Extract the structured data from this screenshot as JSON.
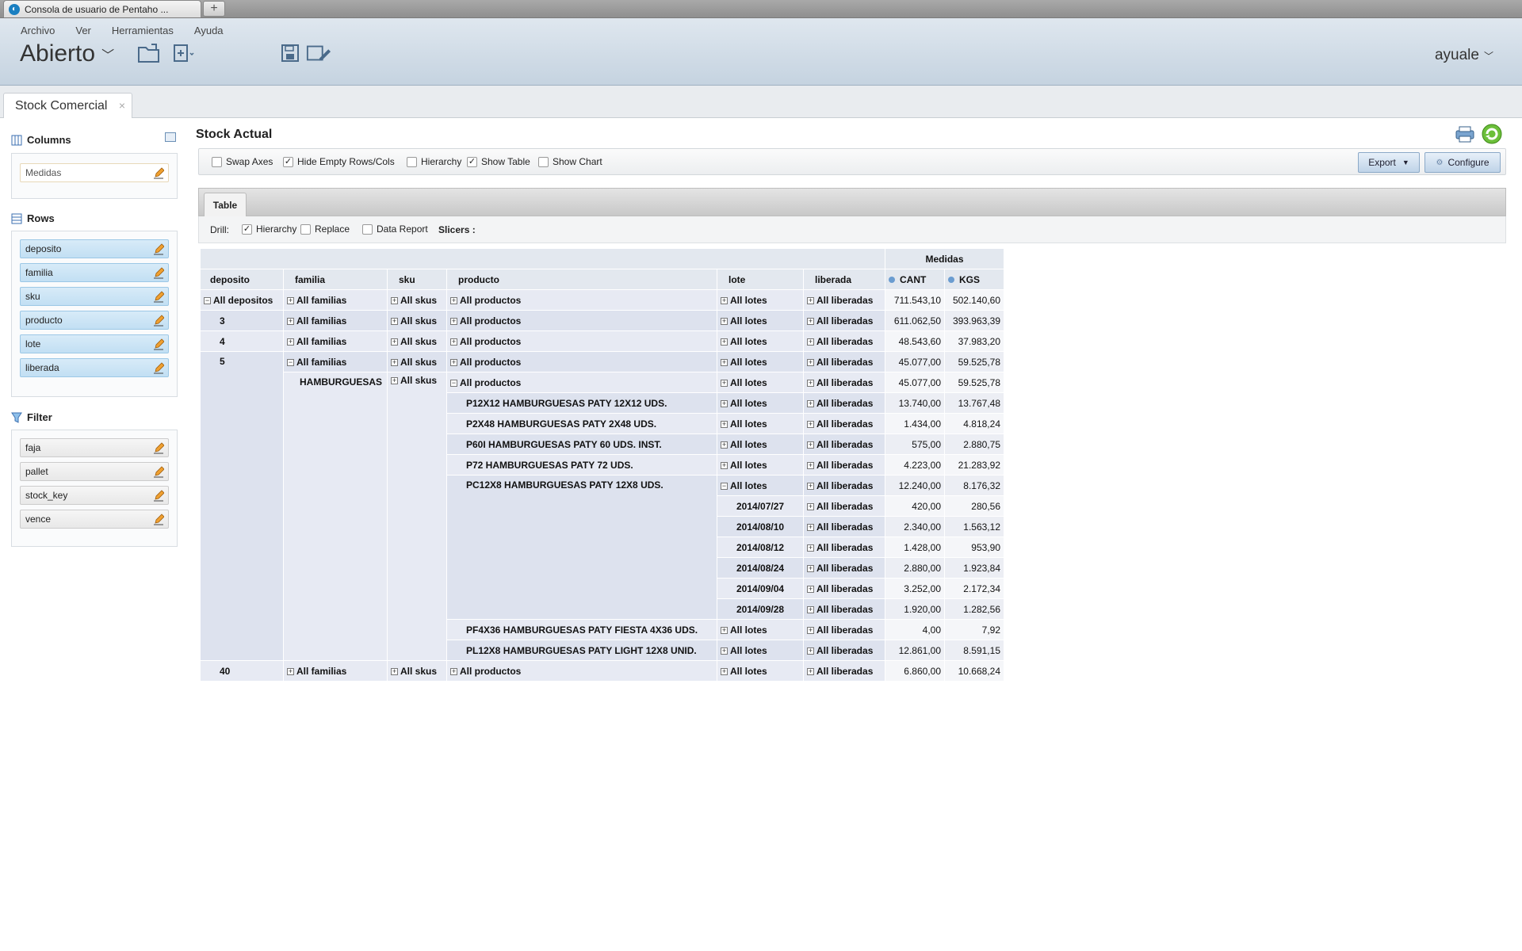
{
  "browser": {
    "tab_title": "Consola de usuario de Pentaho ...",
    "new_tab": "+"
  },
  "header": {
    "menu": [
      "Archivo",
      "Ver",
      "Herramientas",
      "Ayuda"
    ],
    "perspective": "Abierto",
    "user": "ayuale"
  },
  "doc_tab": {
    "label": "Stock Comercial",
    "close": "×"
  },
  "sidebar": {
    "columns_title": "Columns",
    "columns": [
      "Medidas"
    ],
    "rows_title": "Rows",
    "rows": [
      "deposito",
      "familia",
      "sku",
      "producto",
      "lote",
      "liberada"
    ],
    "filter_title": "Filter",
    "filters": [
      "faja",
      "pallet",
      "stock_key",
      "vence"
    ]
  },
  "report": {
    "title": "Stock Actual",
    "options": {
      "swap_axes": "Swap Axes",
      "hide_empty": "Hide Empty Rows/Cols",
      "hierarchy": "Hierarchy",
      "show_table": "Show Table",
      "show_chart": "Show Chart"
    },
    "export": "Export",
    "configure": "Configure",
    "table_tab": "Table",
    "drill": {
      "label": "Drill:",
      "hierarchy": "Hierarchy",
      "replace": "Replace",
      "data_report": "Data Report",
      "slicers": "Slicers :"
    }
  },
  "pivot": {
    "measures_group": "Medidas",
    "headers": [
      "deposito",
      "familia",
      "sku",
      "producto",
      "lote",
      "liberada"
    ],
    "measures": [
      "CANT",
      "KGS"
    ],
    "labels": {
      "all_depositos": "All depositos",
      "all_familias": "All familias",
      "all_skus": "All skus",
      "all_productos": "All productos",
      "all_lotes": "All lotes",
      "all_liberadas": "All liberadas",
      "hamburguesas": "HAMBURGUESAS"
    },
    "rows": [
      {
        "deposito": "All depositos",
        "cant": "711.543,10",
        "kgs": "502.140,60"
      },
      {
        "deposito": "3",
        "cant": "611.062,50",
        "kgs": "393.963,39"
      },
      {
        "deposito": "4",
        "cant": "48.543,60",
        "kgs": "37.983,20"
      },
      {
        "deposito": "5",
        "cant": "45.077,00",
        "kgs": "59.525,78"
      },
      {
        "familia": "HAMBURGUESAS",
        "cant": "45.077,00",
        "kgs": "59.525,78"
      },
      {
        "producto": "P12X12 HAMBURGUESAS PATY 12X12 UDS.",
        "cant": "13.740,00",
        "kgs": "13.767,48"
      },
      {
        "producto": "P2X48 HAMBURGUESAS PATY 2X48 UDS.",
        "cant": "1.434,00",
        "kgs": "4.818,24"
      },
      {
        "producto": "P60I HAMBURGUESAS PATY 60 UDS. INST.",
        "cant": "575,00",
        "kgs": "2.880,75"
      },
      {
        "producto": "P72 HAMBURGUESAS PATY 72 UDS.",
        "cant": "4.223,00",
        "kgs": "21.283,92"
      },
      {
        "producto": "PC12X8 HAMBURGUESAS PATY 12X8 UDS.",
        "cant": "12.240,00",
        "kgs": "8.176,32"
      },
      {
        "lote": "2014/07/27",
        "cant": "420,00",
        "kgs": "280,56"
      },
      {
        "lote": "2014/08/10",
        "cant": "2.340,00",
        "kgs": "1.563,12"
      },
      {
        "lote": "2014/08/12",
        "cant": "1.428,00",
        "kgs": "953,90"
      },
      {
        "lote": "2014/08/24",
        "cant": "2.880,00",
        "kgs": "1.923,84"
      },
      {
        "lote": "2014/09/04",
        "cant": "3.252,00",
        "kgs": "2.172,34"
      },
      {
        "lote": "2014/09/28",
        "cant": "1.920,00",
        "kgs": "1.282,56"
      },
      {
        "producto": "PF4X36 HAMBURGUESAS PATY FIESTA 4X36 UDS.",
        "cant": "4,00",
        "kgs": "7,92"
      },
      {
        "producto": "PL12X8 HAMBURGUESAS PATY LIGHT 12X8 UNID.",
        "cant": "12.861,00",
        "kgs": "8.591,15"
      },
      {
        "deposito": "40",
        "cant": "6.860,00",
        "kgs": "10.668,24"
      }
    ]
  }
}
